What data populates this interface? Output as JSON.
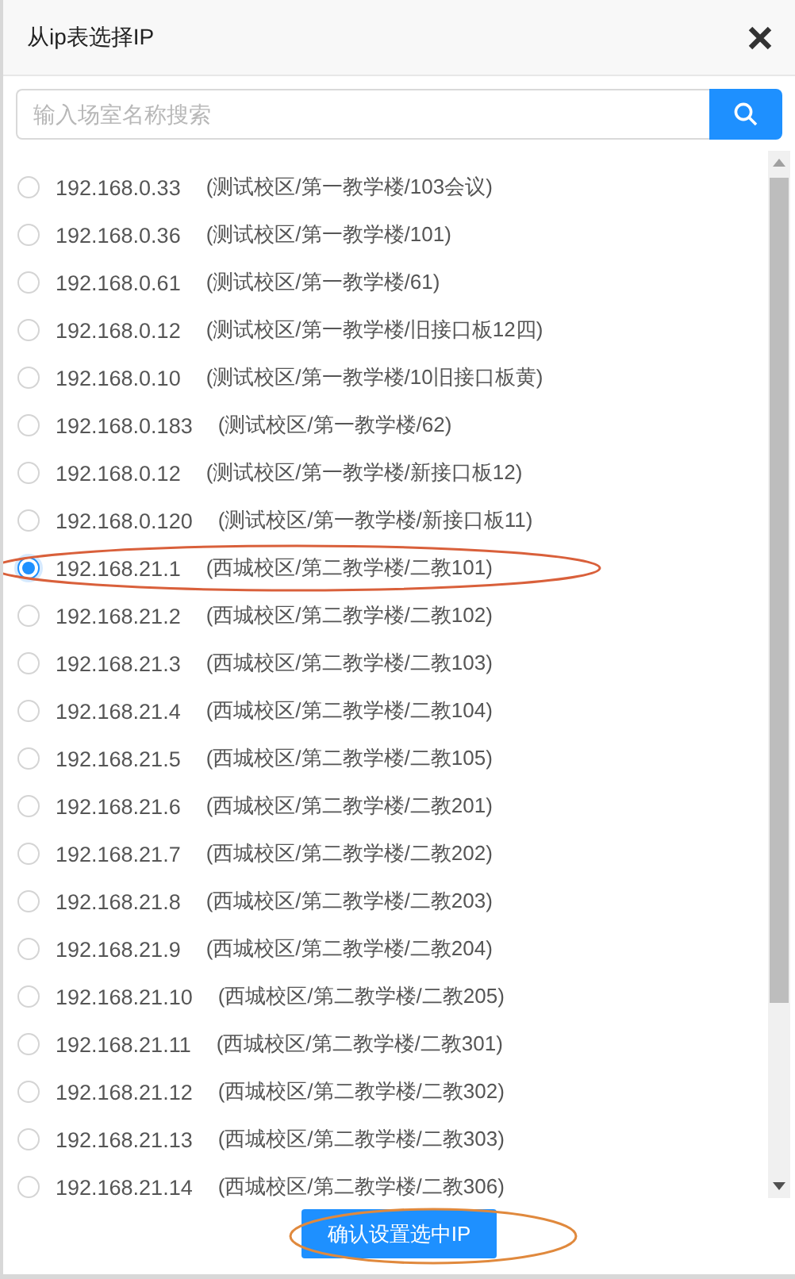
{
  "dialog": {
    "title": "从ip表选择IP"
  },
  "search": {
    "placeholder": "输入场室名称搜索"
  },
  "rows": [
    {
      "ip": "192.168.0.33",
      "location": "(测试校区/第一教学楼/103会议)",
      "selected": false
    },
    {
      "ip": "192.168.0.36",
      "location": "(测试校区/第一教学楼/101)",
      "selected": false
    },
    {
      "ip": "192.168.0.61",
      "location": "(测试校区/第一教学楼/61)",
      "selected": false
    },
    {
      "ip": "192.168.0.12",
      "location": "(测试校区/第一教学楼/旧接口板12四)",
      "selected": false
    },
    {
      "ip": "192.168.0.10",
      "location": "(测试校区/第一教学楼/10旧接口板黄)",
      "selected": false
    },
    {
      "ip": "192.168.0.183",
      "location": "(测试校区/第一教学楼/62)",
      "selected": false
    },
    {
      "ip": "192.168.0.12",
      "location": "(测试校区/第一教学楼/新接口板12)",
      "selected": false
    },
    {
      "ip": "192.168.0.120",
      "location": "(测试校区/第一教学楼/新接口板11)",
      "selected": false
    },
    {
      "ip": "192.168.21.1",
      "location": "(西城校区/第二教学楼/二教101)",
      "selected": true
    },
    {
      "ip": "192.168.21.2",
      "location": "(西城校区/第二教学楼/二教102)",
      "selected": false
    },
    {
      "ip": "192.168.21.3",
      "location": "(西城校区/第二教学楼/二教103)",
      "selected": false
    },
    {
      "ip": "192.168.21.4",
      "location": "(西城校区/第二教学楼/二教104)",
      "selected": false
    },
    {
      "ip": "192.168.21.5",
      "location": "(西城校区/第二教学楼/二教105)",
      "selected": false
    },
    {
      "ip": "192.168.21.6",
      "location": "(西城校区/第二教学楼/二教201)",
      "selected": false
    },
    {
      "ip": "192.168.21.7",
      "location": "(西城校区/第二教学楼/二教202)",
      "selected": false
    },
    {
      "ip": "192.168.21.8",
      "location": "(西城校区/第二教学楼/二教203)",
      "selected": false
    },
    {
      "ip": "192.168.21.9",
      "location": "(西城校区/第二教学楼/二教204)",
      "selected": false
    },
    {
      "ip": "192.168.21.10",
      "location": "(西城校区/第二教学楼/二教205)",
      "selected": false
    },
    {
      "ip": "192.168.21.11",
      "location": "(西城校区/第二教学楼/二教301)",
      "selected": false
    },
    {
      "ip": "192.168.21.12",
      "location": "(西城校区/第二教学楼/二教302)",
      "selected": false
    },
    {
      "ip": "192.168.21.13",
      "location": "(西城校区/第二教学楼/二教303)",
      "selected": false
    },
    {
      "ip": "192.168.21.14",
      "location": "(西城校区/第二教学楼/二教306)",
      "selected": false
    }
  ],
  "confirm_button": {
    "label": "确认设置选中IP"
  }
}
